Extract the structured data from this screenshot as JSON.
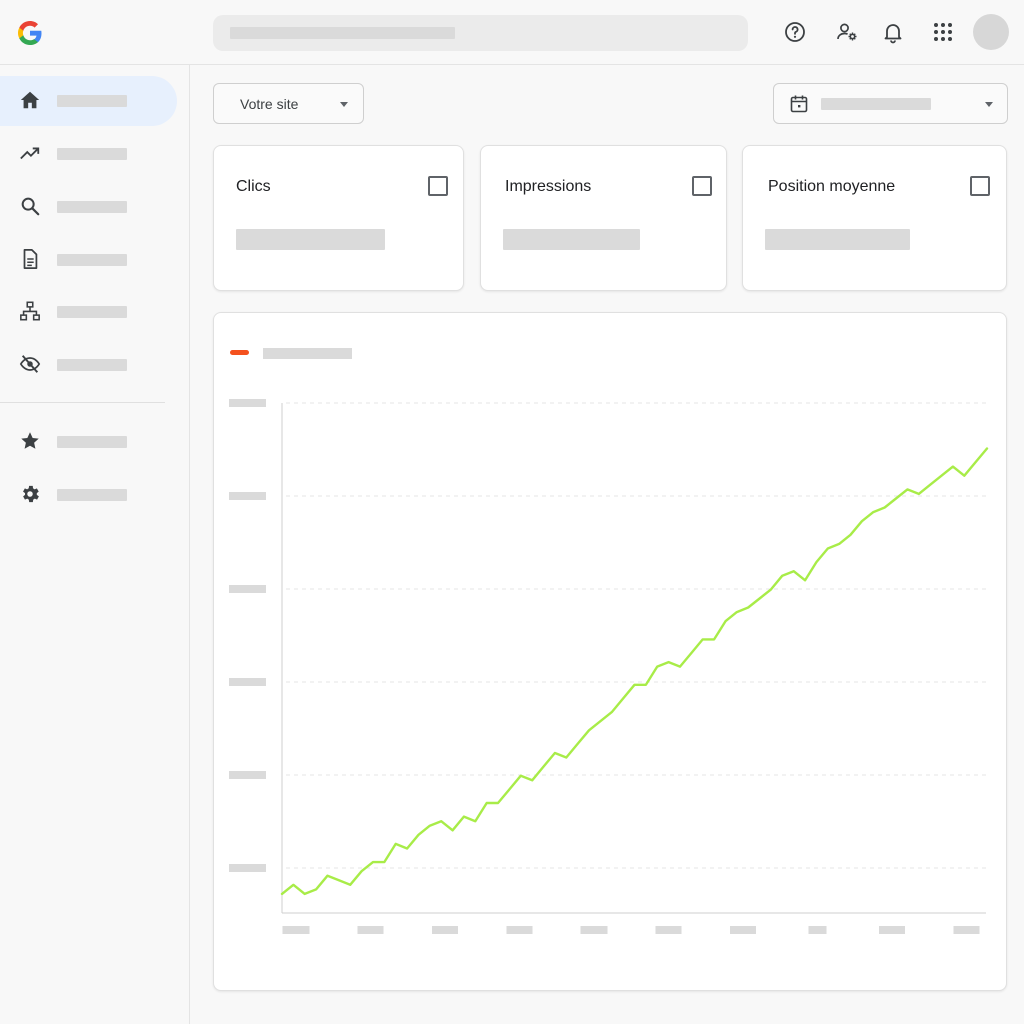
{
  "topbar": {
    "logo": "google-g-logo",
    "icons": [
      "help-icon",
      "manage-users-icon",
      "notifications-bell-icon",
      "apps-grid-icon"
    ]
  },
  "sidebar": {
    "items": [
      {
        "icon": "home-icon",
        "active": true
      },
      {
        "icon": "trending-up-icon",
        "active": false
      },
      {
        "icon": "search-icon",
        "active": false
      },
      {
        "icon": "document-icon",
        "active": false
      },
      {
        "icon": "sitemap-icon",
        "active": false
      },
      {
        "icon": "visibility-off-icon",
        "active": false
      },
      {
        "icon": "star-icon",
        "active": false
      },
      {
        "icon": "settings-gear-icon",
        "active": false
      }
    ]
  },
  "toolbar": {
    "site_select_label": "Votre site",
    "date_icon": "calendar-icon"
  },
  "metrics": [
    {
      "title": "Clics"
    },
    {
      "title": "Impressions"
    },
    {
      "title": "Position moyenne"
    }
  ],
  "colors": {
    "line": "#a8ec48",
    "legend_marker": "#f4511e",
    "active_nav_bg": "#e7f0fd",
    "placeholder": "#dadada"
  },
  "chart_data": {
    "type": "line",
    "title": "",
    "xlabel": "",
    "ylabel": "",
    "grid": true,
    "legend_position": "top-left",
    "series": [
      {
        "values": [
          2,
          4,
          2,
          3,
          6,
          5,
          4,
          7,
          9,
          9,
          13,
          12,
          15,
          17,
          18,
          16,
          19,
          18,
          22,
          22,
          25,
          28,
          27,
          30,
          33,
          32,
          35,
          38,
          40,
          42,
          45,
          48,
          48,
          52,
          53,
          52,
          55,
          58,
          58,
          62,
          64,
          65,
          67,
          69,
          72,
          73,
          71,
          75,
          78,
          79,
          81,
          84,
          86,
          87,
          89,
          91,
          90,
          92,
          94,
          96,
          94,
          97,
          100
        ]
      }
    ],
    "ylim": [
      0,
      110
    ]
  }
}
